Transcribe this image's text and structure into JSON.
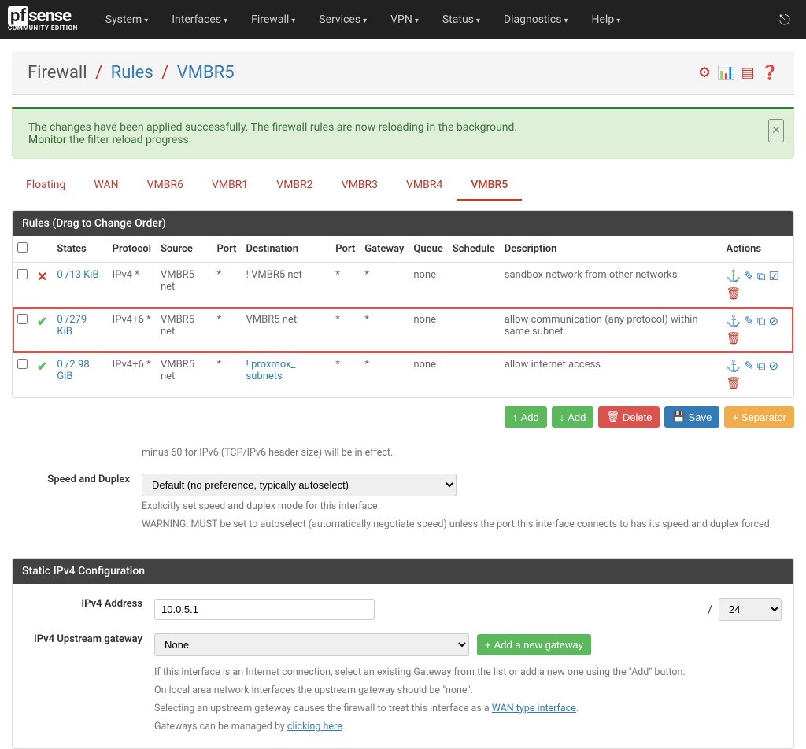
{
  "brand": {
    "pf": "pf",
    "sense": "sense",
    "ce": "COMMUNITY EDITION"
  },
  "nav": [
    "System",
    "Interfaces",
    "Firewall",
    "Services",
    "VPN",
    "Status",
    "Diagnostics",
    "Help"
  ],
  "breadcrumb": {
    "a": "Firewall",
    "b": "Rules",
    "c": "VMBR5"
  },
  "alert": {
    "text1": "The changes have been applied successfully. The firewall rules are now reloading in the background.",
    "monitor": "Monitor",
    "text2": " the filter reload progress."
  },
  "tabs": [
    "Floating",
    "WAN",
    "VMBR6",
    "VMBR1",
    "VMBR2",
    "VMBR3",
    "VMBR4",
    "VMBR5"
  ],
  "activeTab": "VMBR5",
  "rules_header": "Rules (Drag to Change Order)",
  "cols": {
    "states": "States",
    "protocol": "Protocol",
    "source": "Source",
    "port": "Port",
    "dest": "Destination",
    "port2": "Port",
    "gateway": "Gateway",
    "queue": "Queue",
    "schedule": "Schedule",
    "desc": "Description",
    "actions": "Actions"
  },
  "rules": [
    {
      "status": "x",
      "states": "0 /13 KiB",
      "proto": "IPv4 *",
      "source": "VMBR5 net",
      "port": "*",
      "dest": "! VMBR5 net",
      "port2": "*",
      "gw": "*",
      "queue": "none",
      "sched": "",
      "desc": "sandbox network from other networks",
      "highlighted": false,
      "blocked": true
    },
    {
      "status": "check",
      "states": "0 /279 KiB",
      "proto": "IPv4+6 *",
      "source": "VMBR5 net",
      "port": "*",
      "dest": "VMBR5 net",
      "port2": "*",
      "gw": "*",
      "queue": "none",
      "sched": "",
      "desc": "allow communication (any protocol) within same subnet",
      "highlighted": true,
      "blocked": false
    },
    {
      "status": "check",
      "states": "0 /2.98 GiB",
      "proto": "IPv4+6 *",
      "source": "VMBR5 net",
      "port": "*",
      "dest_link": "! proxmox_ subnets",
      "port2": "*",
      "gw": "*",
      "queue": "none",
      "sched": "",
      "desc": "allow internet access",
      "highlighted": false,
      "blocked": false
    }
  ],
  "buttons": {
    "add": "Add",
    "delete": "Delete",
    "save": "Save",
    "separator": "Separator"
  },
  "speed": {
    "partial_help": "minus 60 for IPv6 (TCP/IPv6 header size) will be in effect.",
    "label": "Speed and Duplex",
    "select": "Default (no preference, typically autoselect)",
    "help1": "Explicitly set speed and duplex mode for this interface.",
    "help2": "WARNING: MUST be set to autoselect (automatically negotiate speed) unless the port this interface connects to has its speed and duplex forced."
  },
  "static_header": "Static IPv4 Configuration",
  "ipv4": {
    "label": "IPv4 Address",
    "value": "10.0.5.1",
    "slash": "/",
    "mask": "24"
  },
  "gateway": {
    "label": "IPv4 Upstream gateway",
    "select": "None",
    "btn": "Add a new gateway",
    "h1": "If this interface is an Internet connection, select an existing Gateway from the list or add a new one using the \"Add\" button.",
    "h2": "On local area network interfaces the upstream gateway should be \"none\".",
    "h3a": "Selecting an upstream gateway causes the firewall to treat this interface as a ",
    "h3link": "WAN type interface",
    "h4a": "Gateways can be managed by ",
    "h4link": "clicking here"
  }
}
